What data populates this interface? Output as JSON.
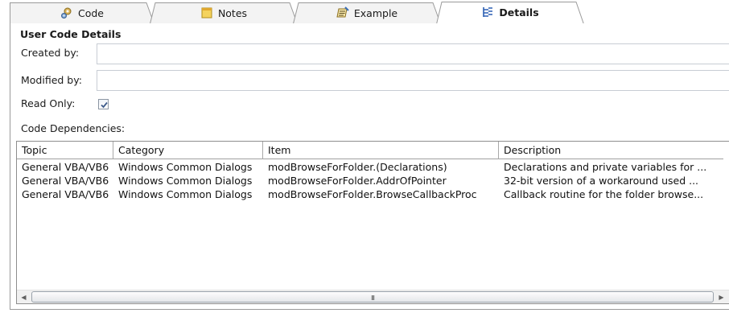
{
  "tabs": [
    {
      "label": "Code",
      "icon": "code-icon",
      "active": false
    },
    {
      "label": "Notes",
      "icon": "notes-icon",
      "active": false
    },
    {
      "label": "Example",
      "icon": "example-icon",
      "active": false
    },
    {
      "label": "Details",
      "icon": "details-icon",
      "active": true
    }
  ],
  "details": {
    "section_title": "User Code Details",
    "created_by_label": "Created by:",
    "created_by_value": "",
    "modified_by_label": "Modified by:",
    "modified_by_value": "",
    "read_only_label": "Read Only:",
    "read_only_checked": true,
    "dependencies_label": "Code Dependencies:"
  },
  "grid": {
    "columns": [
      "Topic",
      "Category",
      "Item",
      "Description"
    ],
    "rows": [
      [
        "General VBA/VB6",
        "Windows Common Dialogs",
        "modBrowseForFolder.(Declarations)",
        "Declarations and private variables for ..."
      ],
      [
        "General VBA/VB6",
        "Windows Common Dialogs",
        "modBrowseForFolder.AddrOfPointer",
        "32-bit version of a workaround used ..."
      ],
      [
        "General VBA/VB6",
        "Windows Common Dialogs",
        "modBrowseForFolder.BrowseCallbackProc",
        "Callback routine for the folder browse..."
      ]
    ]
  },
  "scrollbar": {
    "left_arrow": "◀",
    "right_arrow": "▶",
    "grip": "III"
  },
  "colors": {
    "active_tab": "#ffffff",
    "inactive_tab": "#f3f3f3",
    "border": "#9a9a9a",
    "checkbox_check": "#3c5a8a"
  }
}
